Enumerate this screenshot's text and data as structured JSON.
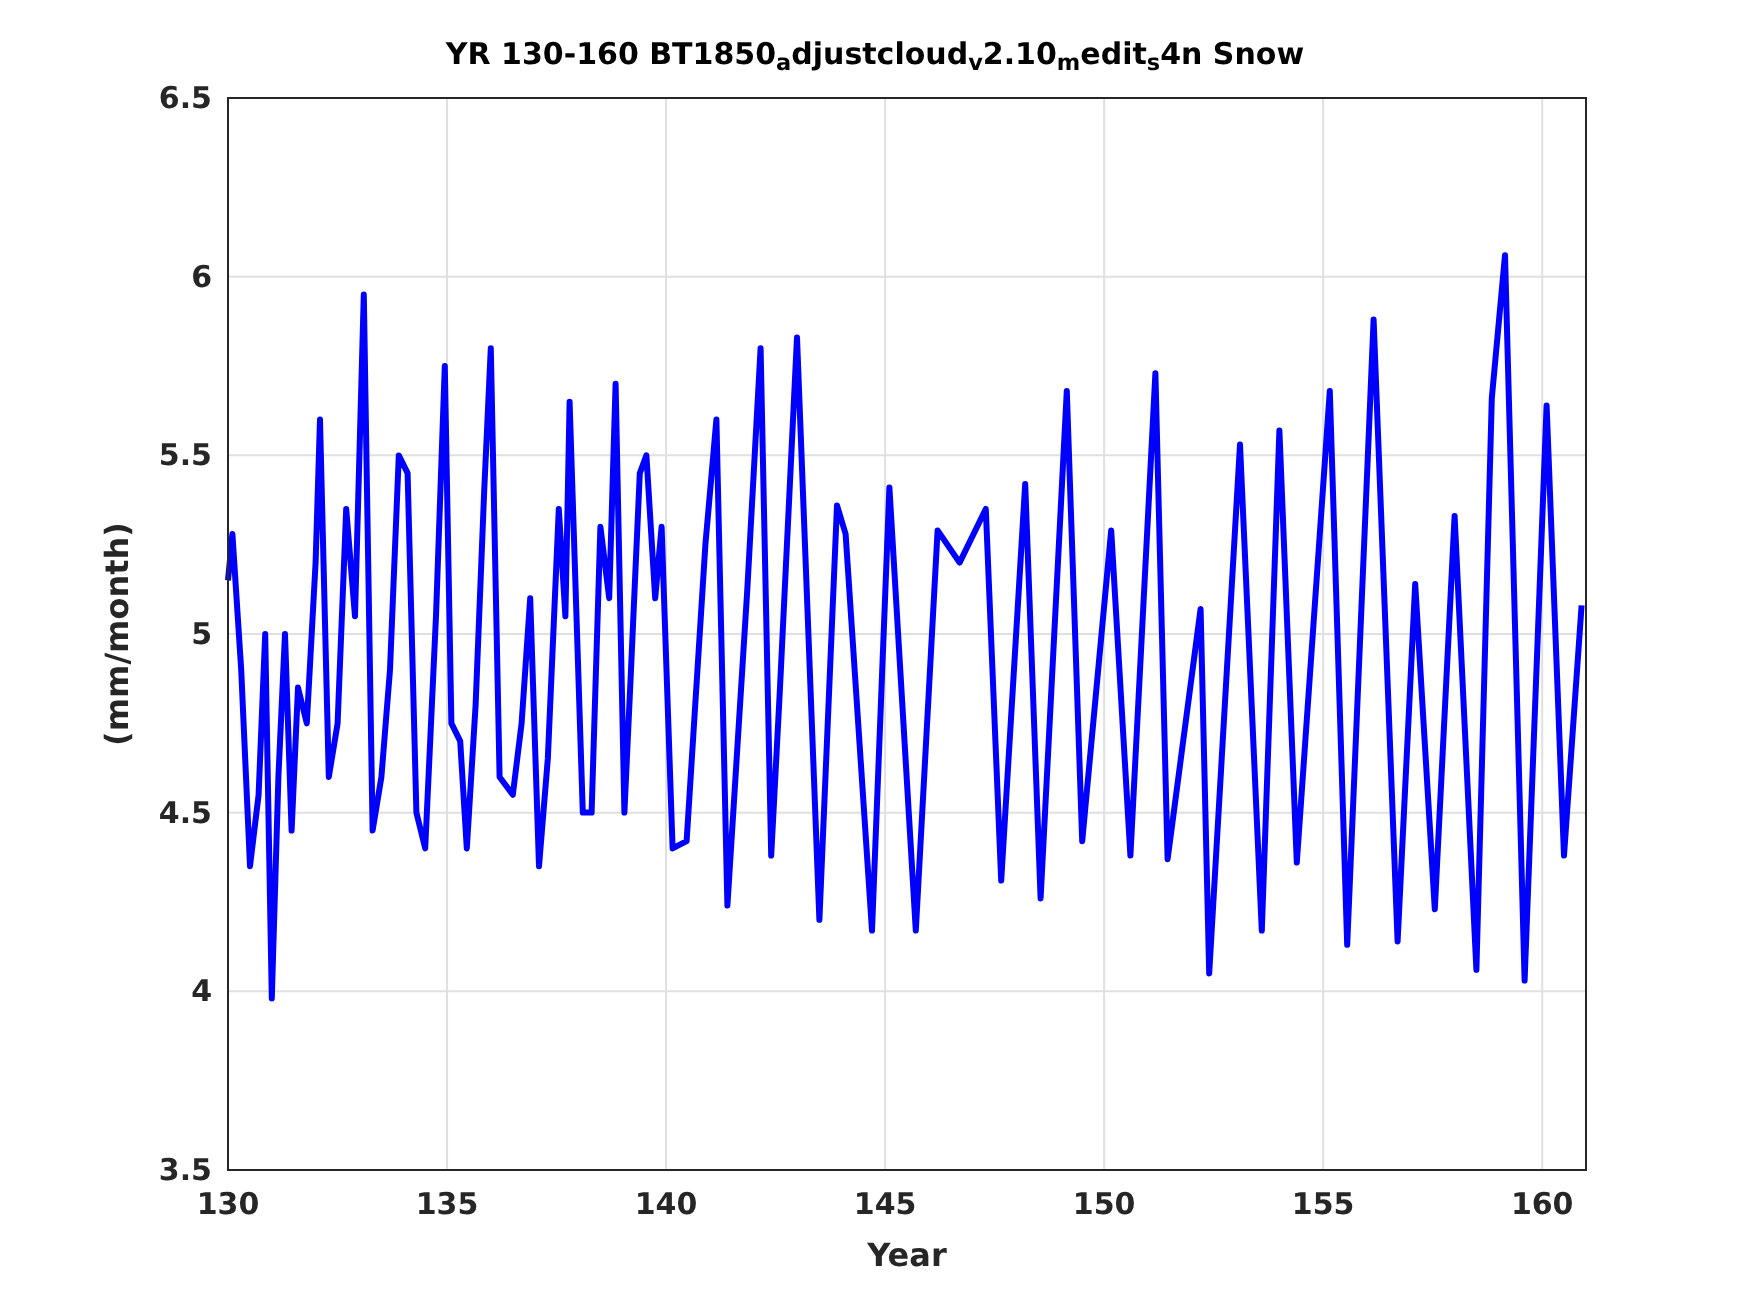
{
  "figure": {
    "chart_data": {
      "type": "line",
      "title": "YR 130-160 BT1850$_{a}$djustcloud$_{v}$2.10$_{m}$edit$_{s}$4n Snow",
      "xlabel": "Year",
      "ylabel": "(mm/month)",
      "x": [
        130.0,
        130.1,
        130.3,
        130.5,
        130.7,
        130.85,
        131.0,
        131.15,
        131.3,
        131.45,
        131.6,
        131.8,
        132.0,
        132.1,
        132.3,
        132.5,
        132.7,
        132.9,
        133.1,
        133.3,
        133.5,
        133.7,
        133.9,
        134.1,
        134.3,
        134.5,
        134.75,
        134.95,
        135.1,
        135.3,
        135.45,
        135.65,
        135.85,
        136.0,
        136.2,
        136.5,
        136.7,
        136.9,
        137.1,
        137.3,
        137.55,
        137.7,
        137.8,
        138.1,
        138.3,
        138.5,
        138.7,
        138.85,
        139.05,
        139.2,
        139.4,
        139.55,
        139.75,
        139.9,
        140.15,
        140.47,
        140.9,
        141.15,
        141.4,
        141.85,
        142.16,
        142.4,
        142.6,
        142.99,
        143.5,
        143.9,
        144.1,
        144.7,
        145.1,
        145.7,
        146.2,
        146.7,
        147.3,
        147.65,
        148.2,
        148.55,
        149.15,
        149.5,
        150.16,
        150.6,
        151.17,
        151.45,
        152.2,
        152.4,
        153.1,
        153.6,
        154.0,
        154.4,
        155.15,
        155.55,
        156.15,
        156.7,
        157.1,
        157.55,
        158.0,
        158.5,
        158.85,
        159.15,
        159.6,
        160.1,
        160.5,
        160.9
      ],
      "series": [
        {
          "color": "#0000ff",
          "values": [
            5.15,
            5.28,
            4.9,
            4.35,
            4.55,
            5.0,
            3.98,
            4.6,
            5.0,
            4.45,
            4.85,
            4.75,
            5.2,
            5.6,
            4.6,
            4.75,
            5.35,
            5.05,
            5.95,
            4.45,
            4.6,
            4.9,
            5.5,
            5.45,
            4.5,
            4.4,
            5.05,
            5.75,
            4.75,
            4.7,
            4.4,
            4.8,
            5.4,
            5.8,
            4.6,
            4.55,
            4.75,
            5.1,
            4.35,
            4.65,
            5.35,
            5.05,
            5.65,
            4.5,
            4.5,
            5.3,
            5.1,
            5.7,
            4.5,
            4.9,
            5.45,
            5.5,
            5.1,
            5.3,
            4.4,
            4.42,
            5.25,
            5.6,
            4.24,
            5.12,
            5.8,
            4.38,
            4.85,
            5.83,
            4.2,
            5.36,
            5.28,
            4.17,
            5.41,
            4.17,
            5.29,
            5.2,
            5.35,
            4.31,
            5.42,
            4.26,
            5.68,
            4.42,
            5.29,
            4.38,
            5.73,
            4.37,
            5.07,
            4.05,
            5.53,
            4.17,
            5.57,
            4.36,
            5.68,
            4.13,
            5.88,
            4.14,
            5.14,
            4.23,
            5.33,
            4.06,
            5.66,
            6.06,
            4.03,
            5.64,
            4.38,
            5.08
          ]
        }
      ],
      "grid": true,
      "xlim": [
        130,
        161
      ],
      "ylim": [
        3.5,
        6.5
      ],
      "xticks": [
        130,
        135,
        140,
        145,
        150,
        155,
        160
      ],
      "yticks": [
        3.5,
        4,
        4.5,
        5,
        5.5,
        6,
        6.5
      ]
    }
  }
}
